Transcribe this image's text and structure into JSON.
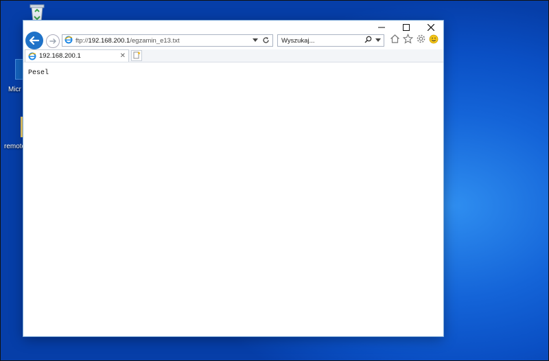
{
  "desktop": {
    "icons": [
      {
        "label": "Micr"
      },
      {
        "label": "remote"
      }
    ]
  },
  "window": {
    "buttons": {
      "minimize": "–",
      "maximize": "☐",
      "close": "✕"
    }
  },
  "address_bar": {
    "url_prefix": "ftp://",
    "url_host": "192.168.200.1",
    "url_path": "/egzamin_e13.txt"
  },
  "search": {
    "placeholder": "Wyszukaj..."
  },
  "tab": {
    "title": "192.168.200.1"
  },
  "content": {
    "text": "Pesel"
  },
  "icons": [
    "recycle-bin-icon",
    "edge-icon",
    "folder-icon",
    "back-arrow-icon",
    "forward-arrow-icon",
    "ie-logo-icon",
    "dropdown-icon",
    "refresh-icon",
    "search-icon",
    "home-icon",
    "favorites-star-icon",
    "settings-gear-icon",
    "feedback-smiley-icon",
    "new-tab-icon",
    "close-tab-icon"
  ],
  "colors": {
    "desktop_blue": "#0a4fc4",
    "accent": "#1f72c8",
    "ie_blue": "#1e88e5",
    "smiley": "#f5c518"
  }
}
